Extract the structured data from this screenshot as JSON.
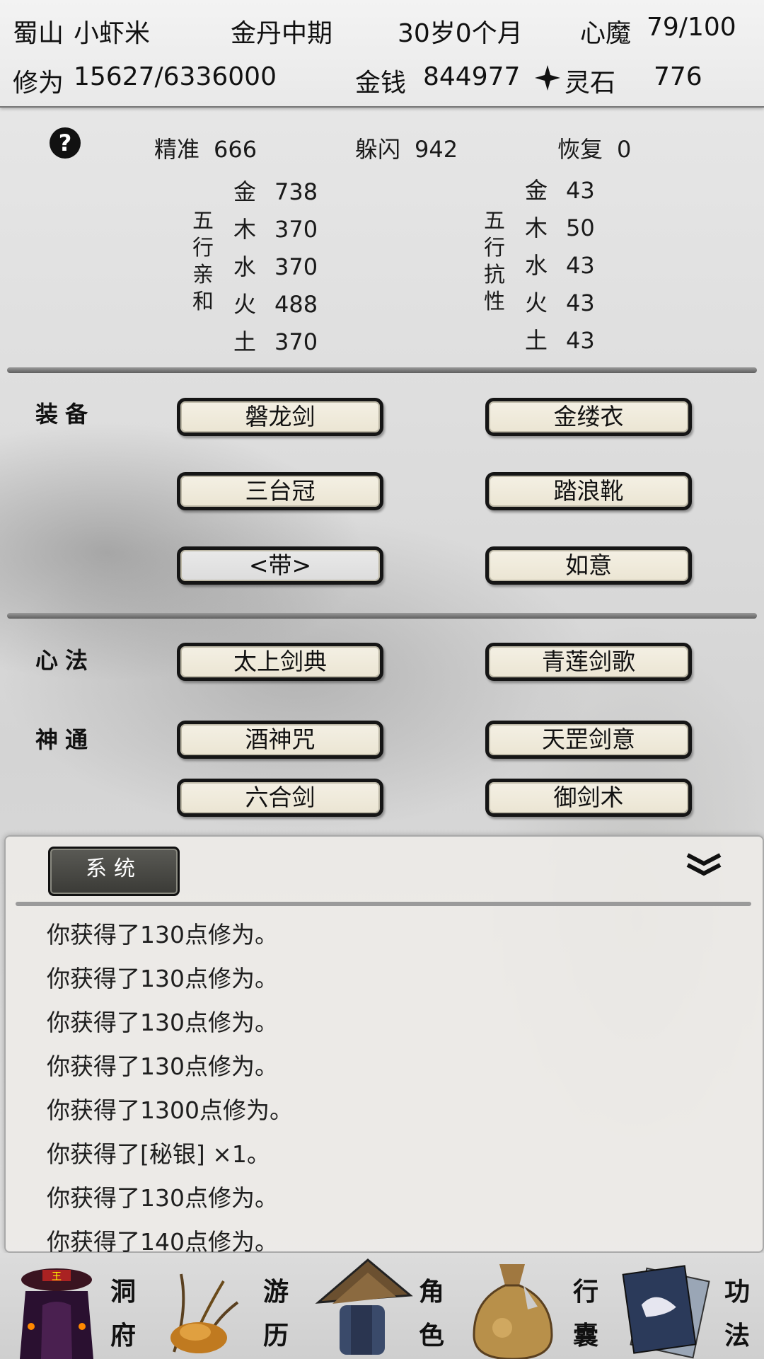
{
  "header": {
    "location": "蜀山",
    "name": "小虾米",
    "realm": "金丹中期",
    "age": "30岁0个月",
    "demon_label": "心魔",
    "demon_value": "79/100",
    "cultivation_label": "修为",
    "cultivation_value": "15627/6336000",
    "money_label": "金钱",
    "money_value": "844977",
    "spirit_label": "灵石",
    "spirit_value": "776"
  },
  "stats": {
    "precision_label": "精准",
    "precision_value": "666",
    "dodge_label": "躲闪",
    "dodge_value": "942",
    "recover_label": "恢复",
    "recover_value": "0"
  },
  "affinity": {
    "label": [
      "五",
      "行",
      "亲",
      "和"
    ],
    "items": [
      {
        "el": "金",
        "val": "738"
      },
      {
        "el": "木",
        "val": "370"
      },
      {
        "el": "水",
        "val": "370"
      },
      {
        "el": "火",
        "val": "488"
      },
      {
        "el": "土",
        "val": "370"
      }
    ]
  },
  "resist": {
    "label": [
      "五",
      "行",
      "抗",
      "性"
    ],
    "items": [
      {
        "el": "金",
        "val": "43"
      },
      {
        "el": "木",
        "val": "50"
      },
      {
        "el": "水",
        "val": "43"
      },
      {
        "el": "火",
        "val": "43"
      },
      {
        "el": "土",
        "val": "43"
      }
    ]
  },
  "equipment": {
    "label": "装备",
    "items": [
      "磐龙剑",
      "金缕衣",
      "三台冠",
      "踏浪靴",
      "<带>",
      "如意"
    ]
  },
  "mind": {
    "label": "心法",
    "items": [
      "太上剑典",
      "青莲剑歌"
    ]
  },
  "powers": {
    "label": "神通",
    "items": [
      "酒神咒",
      "天罡剑意",
      "六合剑",
      "御剑术"
    ]
  },
  "log": {
    "tab": "系统",
    "lines": [
      "你获得了130点修为。",
      "你获得了130点修为。",
      "你获得了130点修为。",
      "你获得了130点修为。",
      "你获得了1300点修为。",
      "你获得了[秘银] ×1。",
      "你获得了130点修为。",
      "你获得了140点修为。"
    ]
  },
  "nav": {
    "cave": [
      "洞",
      "府"
    ],
    "travel": [
      "游",
      "历"
    ],
    "role": [
      "角",
      "色"
    ],
    "bag": [
      "行",
      "囊"
    ],
    "skill": [
      "功",
      "法"
    ],
    "cave_icon": "cave-gate-icon",
    "travel_icon": "grass-travel-icon",
    "role_icon": "straw-hat-character-icon",
    "bag_icon": "bag-icon",
    "skill_icon": "books-icon"
  }
}
